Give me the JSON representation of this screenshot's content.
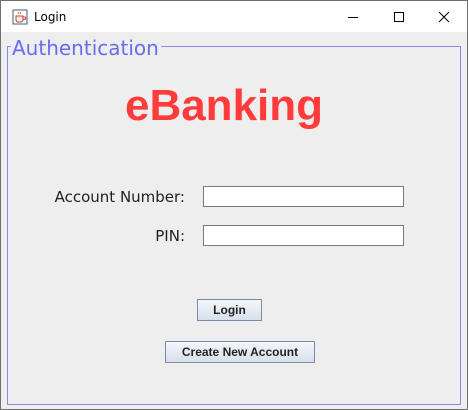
{
  "window": {
    "title": "Login",
    "app_icon": "java-cup-icon",
    "controls": {
      "minimize_icon": "minimize-icon",
      "maximize_icon": "maximize-icon",
      "close_icon": "close-icon"
    }
  },
  "panel": {
    "group_title": "Authentication",
    "heading": "eBanking",
    "account_label": "Account Number:",
    "account_value": "",
    "pin_label": "PIN:",
    "pin_value": "",
    "login_button": "Login",
    "create_account_button": "Create New Account"
  },
  "colors": {
    "heading": "#ff3b3b",
    "group_title": "#6b6bf0",
    "group_border": "#8a8ae6",
    "background": "#eeeeee"
  }
}
